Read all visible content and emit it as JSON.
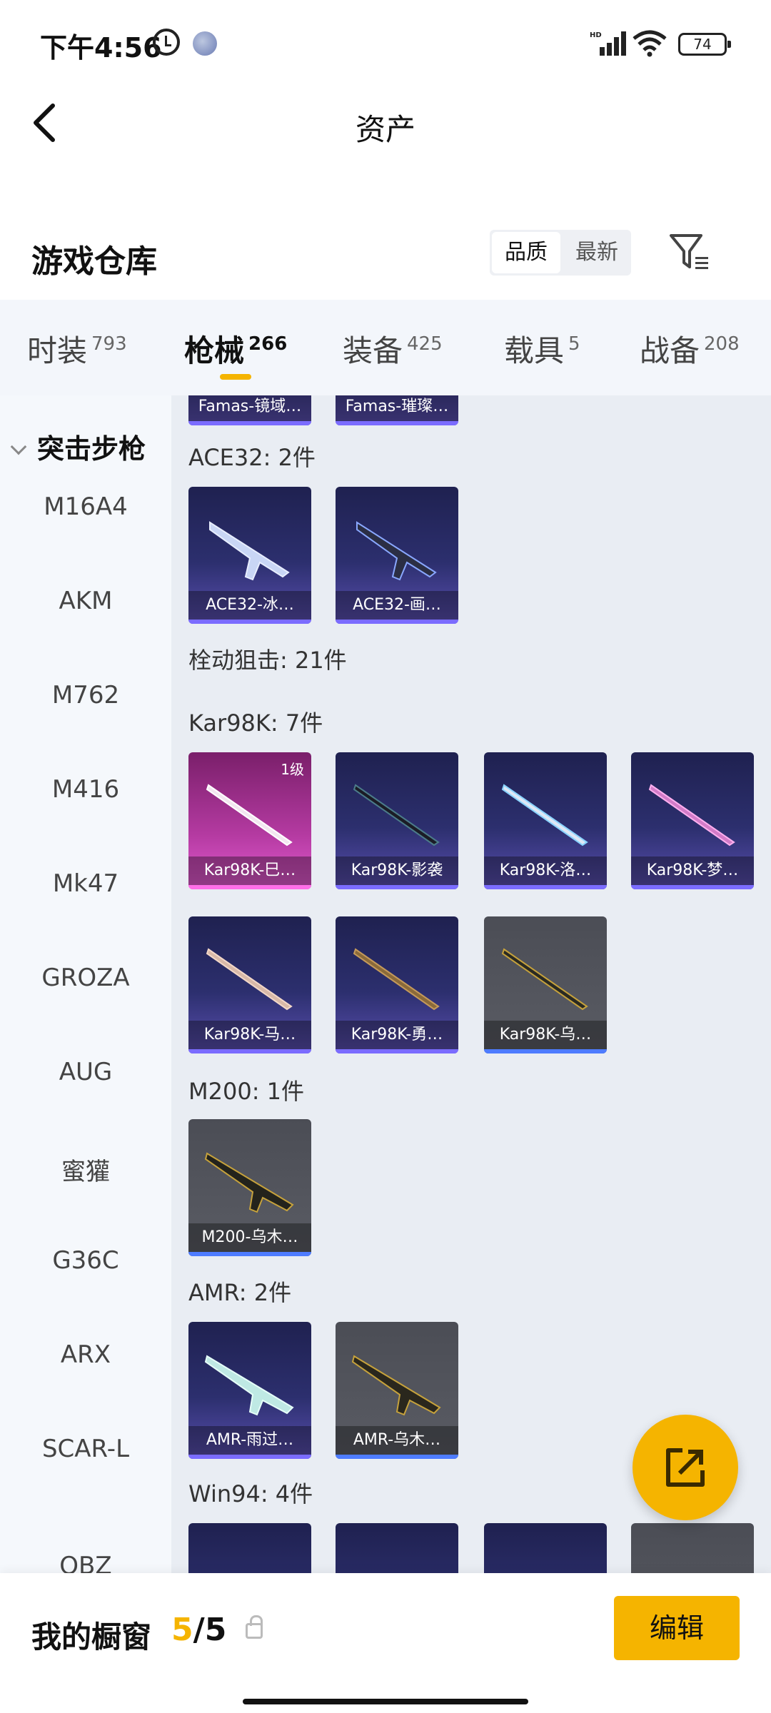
{
  "status_bar": {
    "time": "下午4:56",
    "hd": "HD",
    "battery": "74"
  },
  "nav": {
    "title": "资产"
  },
  "warehouse": {
    "label": "游戏仓库",
    "sort_options": [
      "品质",
      "最新"
    ]
  },
  "tabs": [
    {
      "label": "时装",
      "count": "793"
    },
    {
      "label": "枪械",
      "count": "266"
    },
    {
      "label": "装备",
      "count": "425"
    },
    {
      "label": "载具",
      "count": "5"
    },
    {
      "label": "战备",
      "count": "208"
    }
  ],
  "sidebar": {
    "group": "突击步枪",
    "items": [
      "M16A4",
      "AKM",
      "M762",
      "M416",
      "Mk47",
      "GROZA",
      "AUG",
      "蜜獾",
      "G36C",
      "ARX",
      "SCAR-L",
      "QBZ"
    ]
  },
  "content": {
    "partial_cards": [
      "Famas-镜域…",
      "Famas-璀璨…"
    ],
    "sections": [
      {
        "title": "ACE32: 2件",
        "cards": [
          "ACE32-冰…",
          "ACE32-画…"
        ]
      },
      {
        "title": "栓动狙击: 21件"
      },
      {
        "title": "Kar98K: 7件",
        "cards": [
          "Kar98K-巳…",
          "Kar98K-影袭",
          "Kar98K-洛…",
          "Kar98K-梦…",
          "Kar98K-马…",
          "Kar98K-勇…",
          "Kar98K-乌…"
        ],
        "level": "1级"
      },
      {
        "title": "M200: 1件",
        "cards": [
          "M200-乌木…"
        ]
      },
      {
        "title": "AMR: 2件",
        "cards": [
          "AMR-雨过…",
          "AMR-乌木…"
        ]
      },
      {
        "title": "Win94: 4件"
      }
    ]
  },
  "bottom_bar": {
    "label": "我的橱窗",
    "current": "5",
    "separator": "/",
    "total": "5",
    "edit_label": "编辑"
  },
  "colors": {
    "accent": "#f5b400",
    "purple_card": "#2c2f6e",
    "pink_card": "#b43aa1",
    "gray_card": "#55575f"
  }
}
